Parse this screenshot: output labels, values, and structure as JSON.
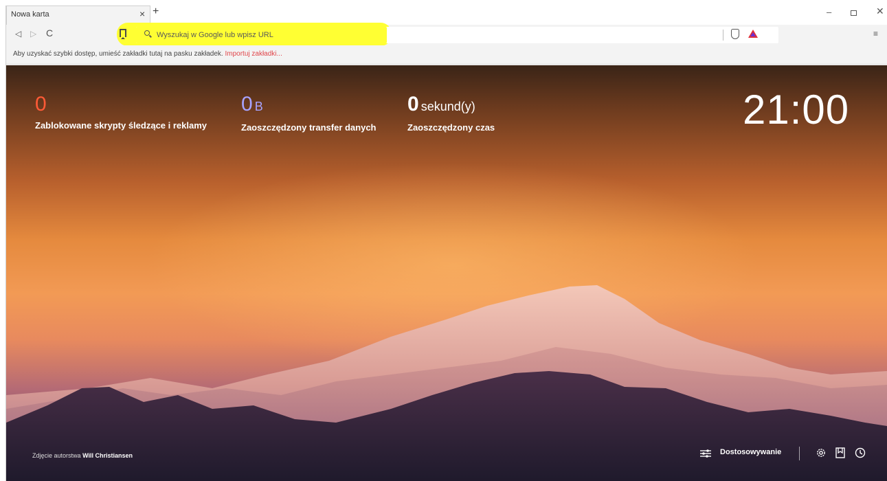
{
  "tab": {
    "title": "Nowa karta",
    "close": "×",
    "new": "+"
  },
  "window": {
    "minimize": "‒",
    "close": "✕"
  },
  "toolbar": {
    "back": "◁",
    "forward": "▷",
    "reload": "C",
    "search_placeholder": "Wyszukaj w Google lub wpisz URL",
    "menu": "≡"
  },
  "bookmarks_bar": {
    "message": "Aby uzyskać szybki dostęp, umieść zakładki tutaj na pasku zakładek.",
    "import_link": "Importuj zakładki..."
  },
  "stats": {
    "ads": {
      "value": "0",
      "label": "Zablokowane skrypty śledzące i reklamy"
    },
    "data": {
      "value": "0",
      "unit": "B",
      "label": "Zaoszczędzony transfer danych"
    },
    "time": {
      "value": "0",
      "unit": "sekund(y)",
      "label": "Zaoszczędzony czas"
    }
  },
  "clock": "21:00",
  "photo_credit": {
    "prefix": "Zdjęcie autorstwa",
    "author": "Will Christiansen"
  },
  "footer": {
    "customize_label": "Dostosowywanie"
  },
  "colors": {
    "highlight": "#ffff33",
    "ads_counter": "#ff5a36",
    "data_counter": "#a7a3ff",
    "import_link": "#e0454a"
  }
}
